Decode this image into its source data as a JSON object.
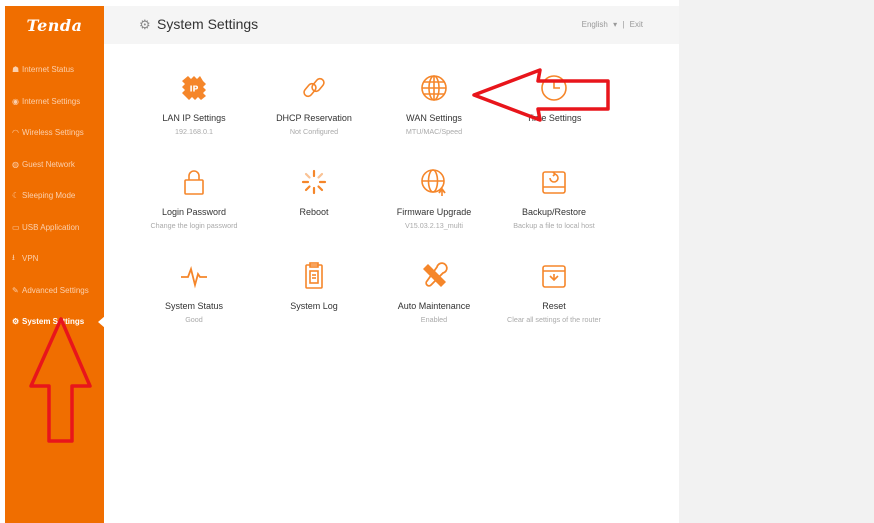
{
  "brand": {
    "logo": "Tenda"
  },
  "sidebar": {
    "items": [
      {
        "label": "Internet Status",
        "icon": "house-icon",
        "glyph": "☗"
      },
      {
        "label": "Internet Settings",
        "icon": "globe-icon",
        "glyph": "◉"
      },
      {
        "label": "Wireless Settings",
        "icon": "wifi-icon",
        "glyph": "◠"
      },
      {
        "label": "Guest Network",
        "icon": "guest-icon",
        "glyph": "◍"
      },
      {
        "label": "Sleeping Mode",
        "icon": "moon-icon",
        "glyph": "☾"
      },
      {
        "label": "USB Application",
        "icon": "usb-icon",
        "glyph": "▭"
      },
      {
        "label": "VPN",
        "icon": "vpn-icon",
        "glyph": "⭳"
      },
      {
        "label": "Advanced Settings",
        "icon": "tools-icon",
        "glyph": "✎"
      },
      {
        "label": "System Settings",
        "icon": "gear-icon",
        "glyph": "⚙"
      }
    ],
    "active_index": 8
  },
  "header": {
    "title": "System Settings",
    "language": "English",
    "language_caret": "▾",
    "separator": "|",
    "exit": "Exit"
  },
  "tiles": [
    {
      "label": "LAN IP Settings",
      "sub": "192.168.0.1",
      "icon": "lan-ip-icon"
    },
    {
      "label": "DHCP Reservation",
      "sub": "Not Configured",
      "icon": "link-icon"
    },
    {
      "label": "WAN Settings",
      "sub": "MTU/MAC/Speed",
      "icon": "globe-icon"
    },
    {
      "label": "Time Settings",
      "sub": "",
      "icon": "clock-icon"
    },
    {
      "label": "Login Password",
      "sub": "Change the login password",
      "icon": "lock-icon"
    },
    {
      "label": "Reboot",
      "sub": "",
      "icon": "spinner-icon"
    },
    {
      "label": "Firmware Upgrade",
      "sub": "V15.03.2.13_multi",
      "icon": "globe-upload-icon"
    },
    {
      "label": "Backup/Restore",
      "sub": "Backup a file to local host",
      "icon": "hard-drive-icon"
    },
    {
      "label": "System Status",
      "sub": "Good",
      "icon": "pulse-icon"
    },
    {
      "label": "System Log",
      "sub": "",
      "icon": "clipboard-icon"
    },
    {
      "label": "Auto Maintenance",
      "sub": "Enabled",
      "icon": "tools-icon"
    },
    {
      "label": "Reset",
      "sub": "Clear all settings of the router",
      "icon": "reset-drive-icon"
    }
  ],
  "colors": {
    "brand_orange": "#f06e00",
    "icon_orange": "#f5862a",
    "annotation_red": "#e8151b"
  }
}
